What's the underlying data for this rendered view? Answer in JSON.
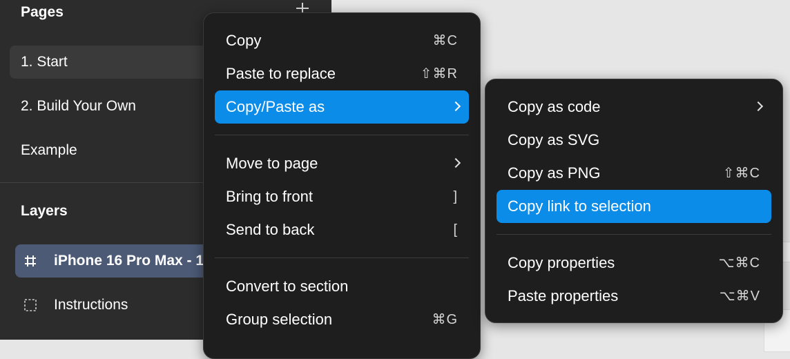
{
  "pages_panel": {
    "title": "Pages",
    "items": [
      {
        "label": "1. Start",
        "active": true
      },
      {
        "label": "2. Build Your Own",
        "active": false
      },
      {
        "label": "Example",
        "active": false
      }
    ]
  },
  "layers_panel": {
    "title": "Layers",
    "items": [
      {
        "label": "iPhone 16 Pro Max - 1",
        "icon": "frame-icon",
        "selected": true
      },
      {
        "label": "Instructions",
        "icon": "section-icon",
        "selected": false
      }
    ]
  },
  "context_menu": {
    "items": [
      {
        "label": "Copy",
        "shortcut": "⌘C"
      },
      {
        "label": "Paste to replace",
        "shortcut": "⇧⌘R"
      },
      {
        "label": "Copy/Paste as",
        "submenu": true,
        "highlighted": true
      },
      {
        "label": "Move to page",
        "submenu": true
      },
      {
        "label": "Bring to front",
        "shortcut": "]"
      },
      {
        "label": "Send to back",
        "shortcut": "["
      },
      {
        "label": "Convert to section",
        "shortcut": ""
      },
      {
        "label": "Group selection",
        "shortcut": "⌘G"
      }
    ]
  },
  "submenu": {
    "items": [
      {
        "label": "Copy as code",
        "submenu": true
      },
      {
        "label": "Copy as SVG",
        "shortcut": ""
      },
      {
        "label": "Copy as PNG",
        "shortcut": "⇧⌘C"
      },
      {
        "label": "Copy link to selection",
        "highlighted": true
      },
      {
        "label": "Copy properties",
        "shortcut": "⌥⌘C"
      },
      {
        "label": "Paste properties",
        "shortcut": "⌥⌘V"
      }
    ]
  },
  "colors": {
    "accent": "#0c8ce9",
    "menu_bg": "#1e1e1e",
    "panel_bg": "#2c2c2c",
    "selected_layer": "#4c5a75"
  }
}
